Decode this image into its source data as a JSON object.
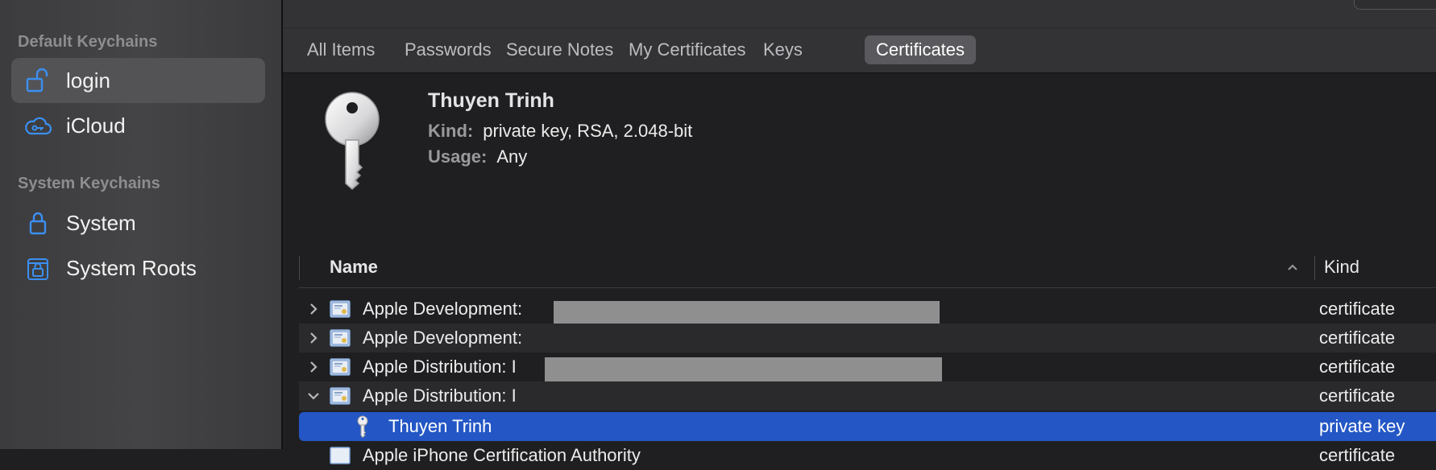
{
  "sidebar": {
    "default_header": "Default Keychains",
    "system_header": "System Keychains",
    "items": [
      {
        "label": "login",
        "icon": "unlocked-padlock-icon",
        "selected": true
      },
      {
        "label": "iCloud",
        "icon": "icloud-key-icon",
        "selected": false
      },
      {
        "label": "System",
        "icon": "padlock-icon",
        "selected": false
      },
      {
        "label": "System Roots",
        "icon": "stacked-padlock-icon",
        "selected": false
      }
    ]
  },
  "tabs": [
    {
      "label": "All Items"
    },
    {
      "label": "Passwords"
    },
    {
      "label": "Secure Notes"
    },
    {
      "label": "My Certificates"
    },
    {
      "label": "Keys"
    },
    {
      "label": "Certificates",
      "active": true
    }
  ],
  "detail": {
    "title": "Thuyen Trinh",
    "kind_label": "Kind:",
    "kind_value": "private key, RSA, 2.048-bit",
    "usage_label": "Usage:",
    "usage_value": "Any",
    "icon": "key-icon"
  },
  "list": {
    "columns": {
      "name": "Name",
      "kind": "Kind"
    },
    "rows": [
      {
        "name": "Apple Development: ",
        "kind": "certificate",
        "expanded": false
      },
      {
        "name": "Apple Development: ",
        "kind": "certificate",
        "expanded": false
      },
      {
        "name": "Apple Distribution: I",
        "kind": "certificate",
        "expanded": false
      },
      {
        "name": "Apple Distribution: I",
        "kind": "certificate",
        "expanded": true
      },
      {
        "name": "Thuyen Trinh",
        "kind": "private key",
        "selected": true,
        "child": true
      },
      {
        "name": "Apple iPhone Certification Authority",
        "kind": "certificate",
        "expanded": false
      }
    ]
  },
  "colors": {
    "accent": "#2457c5",
    "icon_blue": "#3b8ff0",
    "sidebar_bg": "#414143",
    "main_bg": "#1f1f21"
  }
}
